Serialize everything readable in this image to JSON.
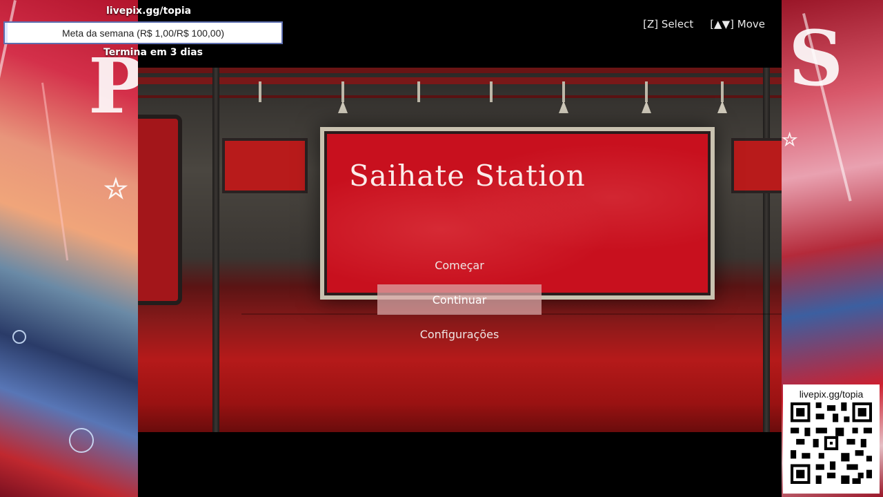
{
  "stream_overlay": {
    "top_url": "livepix.gg/topia",
    "goal": {
      "label": "Meta da semana (R$ 1,00/R$ 100,00)",
      "progress": 0.01,
      "ends": "Termina em 3 dias"
    },
    "qr": {
      "label": "livepix.gg/topia"
    }
  },
  "game": {
    "title": "Saihate Station",
    "controls": [
      {
        "key": "[Z]",
        "action": "Select"
      },
      {
        "key": "[▲▼]",
        "action": "Move"
      }
    ],
    "menu": [
      {
        "label": "Começar",
        "selected": false
      },
      {
        "label": "Continuar",
        "selected": true
      },
      {
        "label": "Configurações",
        "selected": false
      }
    ]
  },
  "colors": {
    "sign_red": "#c8101e",
    "menu_highlight": "#dcaaaa"
  }
}
